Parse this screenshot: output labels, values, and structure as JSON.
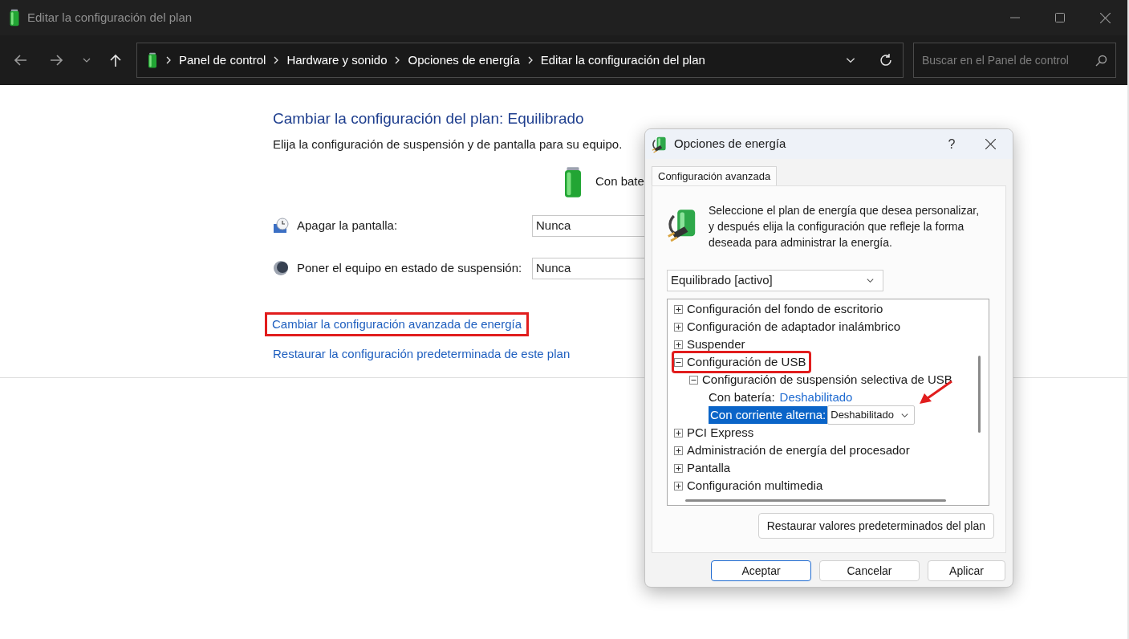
{
  "window": {
    "title": "Editar la configuración del plan"
  },
  "breadcrumb": [
    "Panel de control",
    "Hardware y sonido",
    "Opciones de energía",
    "Editar la configuración del plan"
  ],
  "search": {
    "placeholder": "Buscar en el Panel de control"
  },
  "page": {
    "title": "Cambiar la configuración del plan: Equilibrado",
    "subtitle": "Elija la configuración de suspensión y de pantalla para su equipo.",
    "column_header": "Con bate",
    "settings": [
      {
        "kind": "display",
        "label": "Apagar la pantalla:",
        "value": "Nunca"
      },
      {
        "kind": "sleep",
        "label": "Poner el equipo en estado de suspensión:",
        "value": "Nunca"
      }
    ],
    "links": [
      {
        "label": "Cambiar la configuración avanzada de energía",
        "highlighted": true
      },
      {
        "label": "Restaurar la configuración predeterminada de este plan",
        "highlighted": false
      }
    ]
  },
  "dialog": {
    "title": "Opciones de energía",
    "help": "?",
    "tab": {
      "label": "Configuración avanzada",
      "selected": true
    },
    "description": "Seleccione el plan de energía que desea personalizar, y después elija la configuración que refleje la forma deseada para administrar la energía.",
    "plan": "Equilibrado [activo]",
    "tree": [
      {
        "kind": "group",
        "label": "Configuración del fondo de escritorio",
        "expanded": false,
        "highlighted": false
      },
      {
        "kind": "group",
        "label": "Configuración de adaptador inalámbrico",
        "expanded": false,
        "highlighted": false
      },
      {
        "kind": "group",
        "label": "Suspender",
        "expanded": false,
        "highlighted": false
      },
      {
        "kind": "group",
        "label": "Configuración de USB",
        "expanded": true,
        "highlighted": true,
        "children": [
          {
            "kind": "group",
            "label": "Configuración de suspensión selectiva de USB",
            "expanded": true,
            "highlighted": false,
            "children": [
              {
                "kind": "setting",
                "label": "Con batería:",
                "value": "Deshabilitado",
                "selected": false
              },
              {
                "kind": "setting",
                "label": "Con corriente alterna:",
                "value": "Deshabilitado",
                "selected": true
              }
            ]
          }
        ]
      },
      {
        "kind": "group",
        "label": "PCI Express",
        "expanded": false,
        "highlighted": false
      },
      {
        "kind": "group",
        "label": "Administración de energía del procesador",
        "expanded": false,
        "highlighted": false
      },
      {
        "kind": "group",
        "label": "Pantalla",
        "expanded": false,
        "highlighted": false
      },
      {
        "kind": "group",
        "label": "Configuración multimedia",
        "expanded": false,
        "highlighted": false
      }
    ],
    "restore_button": "Restaurar valores predeterminados del plan",
    "buttons": [
      {
        "label": "Aceptar",
        "default": true
      },
      {
        "label": "Cancelar",
        "default": false
      },
      {
        "label": "Aplicar",
        "default": false
      }
    ]
  }
}
